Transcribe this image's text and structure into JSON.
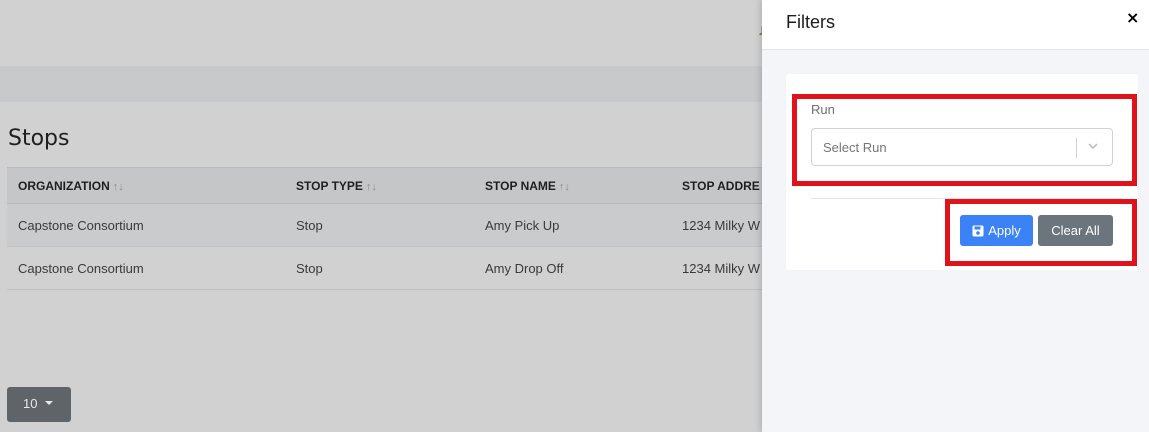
{
  "page": {
    "title": "Stops",
    "topbar_mark": "♫"
  },
  "table": {
    "columns": [
      {
        "label": "ORGANIZATION",
        "sortable": true
      },
      {
        "label": "STOP TYPE",
        "sortable": true
      },
      {
        "label": "STOP NAME",
        "sortable": true
      },
      {
        "label": "STOP ADDRE",
        "sortable": false
      }
    ],
    "sort_icon": "↑↓",
    "rows": [
      [
        "Capstone Consortium",
        "Stop",
        "Amy Pick Up",
        "1234 Milky W"
      ],
      [
        "Capstone Consortium",
        "Stop",
        "Amy Drop Off",
        "1234 Milky W"
      ]
    ]
  },
  "pagination": {
    "page_size": "10"
  },
  "filters_panel": {
    "title": "Filters",
    "close_icon": "×",
    "run_label": "Run",
    "run_placeholder": "Select Run",
    "apply_label": "Apply",
    "clear_label": "Clear All"
  },
  "colors": {
    "highlight": "#e0121b",
    "apply": "#3b82f6",
    "clear": "#6c757d"
  }
}
